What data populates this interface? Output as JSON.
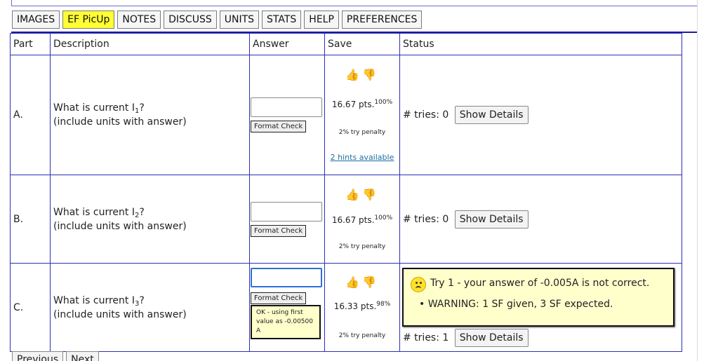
{
  "tabs": [
    {
      "label": "IMAGES",
      "active": false
    },
    {
      "label": "EF PicUp",
      "active": true
    },
    {
      "label": "NOTES",
      "active": false
    },
    {
      "label": "DISCUSS",
      "active": false
    },
    {
      "label": "UNITS",
      "active": false
    },
    {
      "label": "STATS",
      "active": false
    },
    {
      "label": "HELP",
      "active": false
    },
    {
      "label": "PREFERENCES",
      "active": false
    }
  ],
  "table": {
    "headers": {
      "part": "Part",
      "description": "Description",
      "answer": "Answer",
      "save": "Save",
      "status": "Status"
    },
    "rows": [
      {
        "part": "A.",
        "question_prefix": "What is current I",
        "question_sub": "1",
        "question_suffix": "?",
        "hint": "(include units with answer)",
        "answer_value": "",
        "format_check": "Format Check",
        "points": "16.67 pts.",
        "percent": "100%",
        "penalty": "2% try penalty",
        "hints_link": "2 hints available",
        "tries_label": "# tries: 0",
        "details_button": "Show Details"
      },
      {
        "part": "B.",
        "question_prefix": "What is current I",
        "question_sub": "2",
        "question_suffix": "?",
        "hint": "(include units with answer)",
        "answer_value": "",
        "format_check": "Format Check",
        "points": "16.67 pts.",
        "percent": "100%",
        "penalty": "2% try penalty",
        "tries_label": "# tries: 0",
        "details_button": "Show Details"
      },
      {
        "part": "C.",
        "question_prefix": "What is current I",
        "question_sub": "3",
        "question_suffix": "?",
        "hint": "(include units with answer)",
        "answer_value": "",
        "format_check": "Format Check",
        "format_note": "OK - using first value as -0.00500 A",
        "points": "16.33 pts.",
        "percent": "98%",
        "penalty": "2% try penalty",
        "feedback_try": "Try 1 - your answer of -0.005A is not correct.",
        "feedback_warning": "WARNING: 1 SF given, 3 SF expected.",
        "tries_label": "# tries: 1",
        "details_button": "Show Details"
      }
    ]
  },
  "nav": {
    "previous": "Previous",
    "next": "Next"
  },
  "icons": {
    "thumbs_up": "thumbs-up-icon",
    "thumbs_down": "thumbs-down-icon",
    "frown": "frown-face-icon"
  },
  "colors": {
    "active_tab": "#ffff33",
    "table_border": "#2e2eb8",
    "feedback_bg": "#ffffcc",
    "link": "#1a6fa0"
  }
}
